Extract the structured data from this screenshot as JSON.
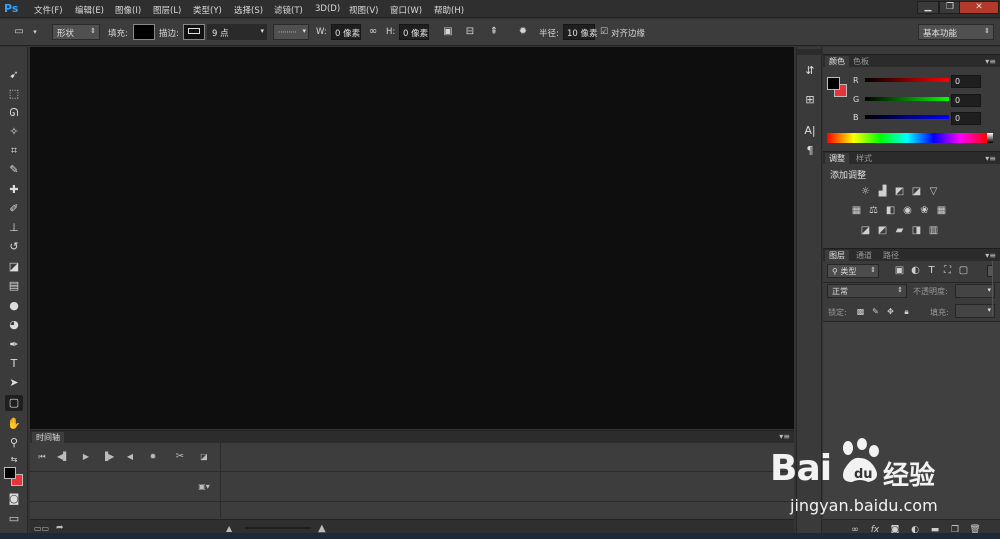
{
  "app": {
    "logo": "Ps"
  },
  "menu": [
    "文件(F)",
    "编辑(E)",
    "图像(I)",
    "图层(L)",
    "类型(Y)",
    "选择(S)",
    "滤镜(T)",
    "3D(D)",
    "视图(V)",
    "窗口(W)",
    "帮助(H)"
  ],
  "window_controls": {
    "minimize": "▁",
    "restore": "❐",
    "close": "✕"
  },
  "options": {
    "mode": "形状",
    "fill_label": "填充:",
    "stroke_label": "描边:",
    "stroke_size": "9 点",
    "w_label": "W:",
    "w_value": "0 像素",
    "h_label": "H:",
    "h_value": "0 像素",
    "radius_label": "半径:",
    "radius_value": "10 像素",
    "align_edges_label": "对齐边缘",
    "workspace": "基本功能"
  },
  "timeline": {
    "tab": "时间轴"
  },
  "color_panel": {
    "tabs": [
      "颜色",
      "色板"
    ],
    "r_label": "R",
    "r_value": "0",
    "g_label": "G",
    "g_value": "0",
    "b_label": "B",
    "b_value": "0",
    "colors": {
      "foreground": "#000000",
      "background": "#e8333b"
    }
  },
  "adjust_panel": {
    "tabs": [
      "调整",
      "样式"
    ],
    "title": "添加调整"
  },
  "layers_panel": {
    "tabs": [
      "图层",
      "通道",
      "路径"
    ],
    "filter_kind": "类型",
    "blend_mode": "正常",
    "opacity_label": "不透明度:",
    "lock_label": "锁定:",
    "fill_label": "填充:"
  },
  "watermark": {
    "brand": "Bai",
    "cn": "经验",
    "url": "jingyan.baidu.com"
  }
}
